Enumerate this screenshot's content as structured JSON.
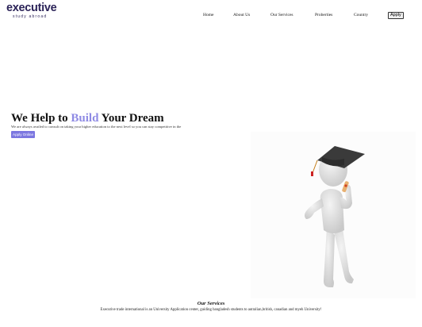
{
  "brand": {
    "name": "executive",
    "tagline": "study abroad"
  },
  "nav": {
    "items": [
      {
        "label": "Home"
      },
      {
        "label": "About Us"
      },
      {
        "label": "Our Services"
      },
      {
        "label": "Proberties"
      },
      {
        "label": "Country"
      }
    ],
    "apply_label": "Apply"
  },
  "hero": {
    "title_start": "We Help to ",
    "title_accent": "Build",
    "title_end": " Your Dream",
    "description": "We are always availed to consult on taking your higher education to the next level so you can stay competitive in the",
    "button_label": "Apply Online"
  },
  "services": {
    "title": "Our Services",
    "description": "Executive trade international is an University Application center, guiding bangladesh students to autralian,british, canadian and myeh University!"
  },
  "colors": {
    "brand": "#2b2358",
    "accent": "#8e8ae4",
    "button": "#7c77e0"
  }
}
